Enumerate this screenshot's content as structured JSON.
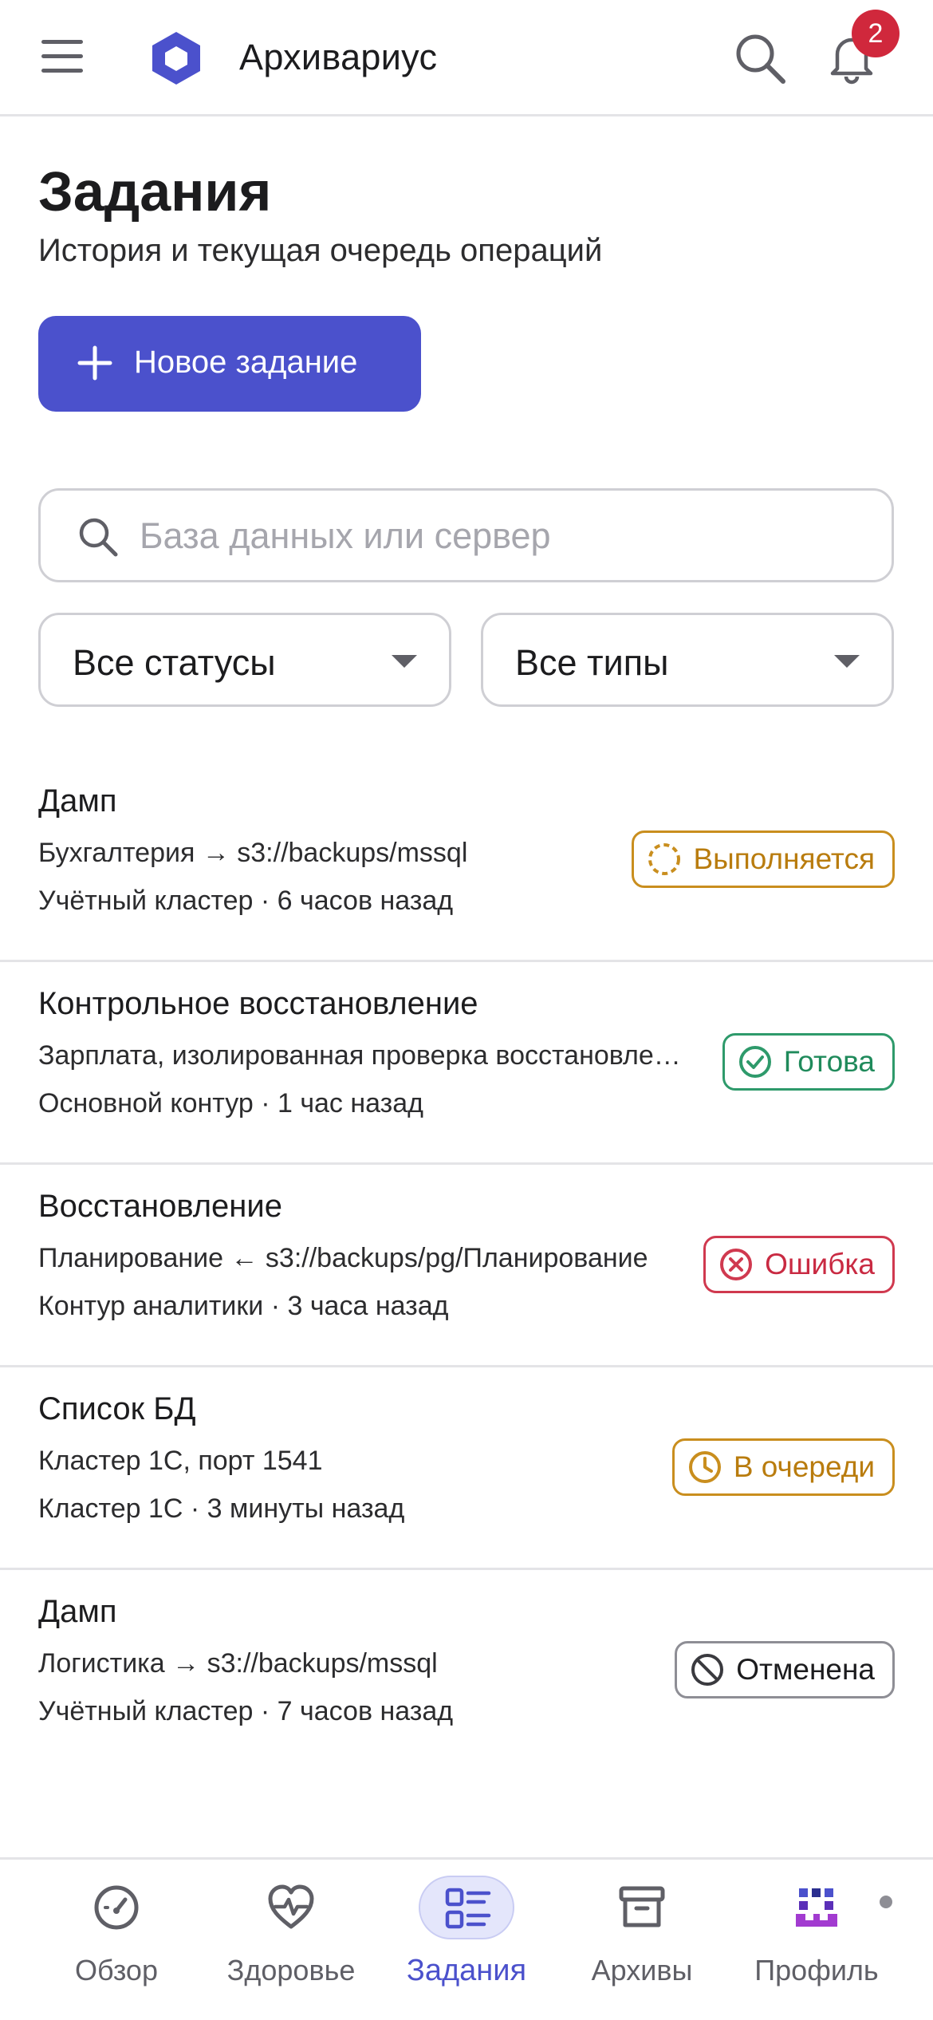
{
  "app": {
    "title": "Архивариус",
    "notifications_count": "2",
    "accent_color": "#4b51cc"
  },
  "page": {
    "title": "Задания",
    "subtitle": "История и текущая очередь операций",
    "new_job_label": "Новое задание"
  },
  "search": {
    "placeholder": "База данных или сервер",
    "value": ""
  },
  "filters": {
    "status": {
      "selected": "Все статусы"
    },
    "type": {
      "selected": "Все типы"
    }
  },
  "jobs": [
    {
      "title": "Дамп",
      "detail": "Бухгалтерия → s3://backups/mssql",
      "meta": "Учётный кластер · 6 часов назад",
      "status": "Выполняется",
      "status_kind": "running",
      "status_icon": "spinner-icon"
    },
    {
      "title": "Контрольное восстановление",
      "detail": "Зарплата, изолированная проверка восстановления",
      "meta": "Основной контур · 1 час назад",
      "status": "Готова",
      "status_kind": "done",
      "status_icon": "check-circle-icon"
    },
    {
      "title": "Восстановление",
      "detail": "Планирование ← s3://backups/pg/Планирование",
      "meta": "Контур аналитики · 3 часа назад",
      "status": "Ошибка",
      "status_kind": "error",
      "status_icon": "x-circle-icon"
    },
    {
      "title": "Список БД",
      "detail": "Кластер 1С, порт 1541",
      "meta": "Кластер 1С · 3 минуты назад",
      "status": "В очереди",
      "status_kind": "queued",
      "status_icon": "clock-icon"
    },
    {
      "title": "Дамп",
      "detail": "Логистика → s3://backups/mssql",
      "meta": "Учётный кластер · 7 часов назад",
      "status": "Отменена",
      "status_kind": "cancelled",
      "status_icon": "ban-icon"
    }
  ],
  "bottom_nav": {
    "items": [
      {
        "label": "Обзор",
        "icon": "gauge-icon",
        "active": false
      },
      {
        "label": "Здоровье",
        "icon": "heart-pulse-icon",
        "active": false
      },
      {
        "label": "Задания",
        "icon": "list-icon",
        "active": true
      },
      {
        "label": "Архивы",
        "icon": "archive-box-icon",
        "active": false
      },
      {
        "label": "Профиль",
        "icon": "avatar",
        "active": false
      }
    ]
  }
}
